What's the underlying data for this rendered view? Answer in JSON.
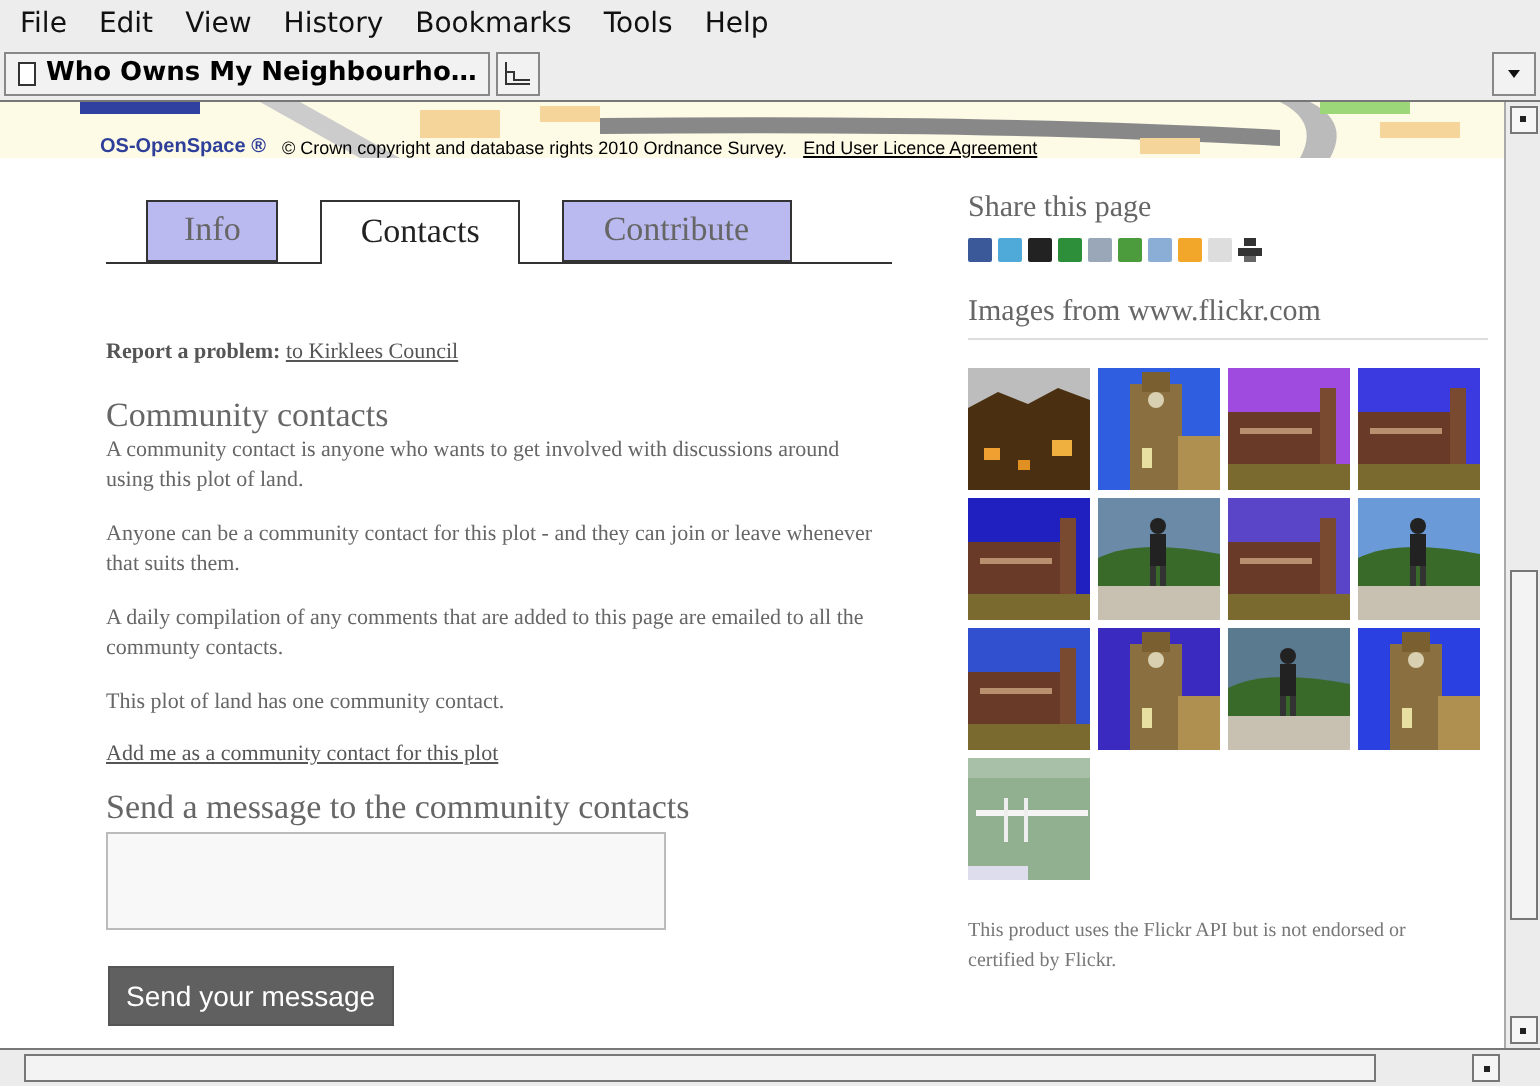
{
  "menu": [
    "File",
    "Edit",
    "View",
    "History",
    "Bookmarks",
    "Tools",
    "Help"
  ],
  "tab": {
    "title": "Who Owns My Neighbourho…"
  },
  "map": {
    "logo": "OS-OpenSpace ®",
    "copyright": "© Crown copyright and database rights 2010 Ordnance Survey.",
    "licence_link": "End User Licence Agreement"
  },
  "content_tabs": [
    {
      "label": "Info",
      "selected": false
    },
    {
      "label": "Contacts",
      "selected": true
    },
    {
      "label": "Contribute",
      "selected": false
    }
  ],
  "report": {
    "label": "Report a problem:",
    "link": "to Kirklees Council"
  },
  "community": {
    "heading": "Community contacts",
    "paragraphs": [
      "A community contact is anyone who wants to get involved with discussions around using this plot of land.",
      "Anyone can be a community contact for this plot - and they can join or leave whenever that suits them.",
      "A daily compilation of any comments that are added to this page are emailed to all the communty contacts.",
      "This plot of land has one community contact."
    ],
    "add_link": "Add me as a community contact for this plot"
  },
  "message": {
    "heading": "Send a message to the community contacts",
    "button": "Send your message"
  },
  "share": {
    "heading": "Share this page"
  },
  "flickr": {
    "heading": "Images from www.flickr.com",
    "note": "This product uses the Flickr API but is not endorsed or certified by Flickr."
  }
}
